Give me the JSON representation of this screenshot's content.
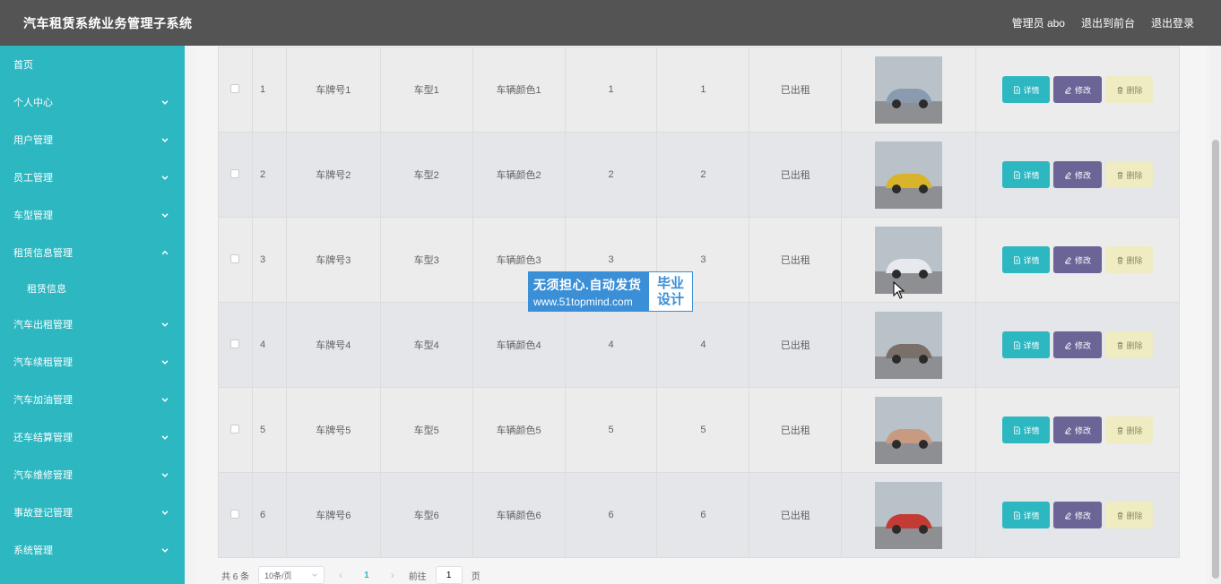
{
  "header": {
    "title": "汽车租赁系统业务管理子系统",
    "admin_label": "管理员 abo",
    "front_label": "退出到前台",
    "logout_label": "退出登录"
  },
  "sidebar": {
    "items": [
      {
        "label": "首页",
        "chevron": "none"
      },
      {
        "label": "个人中心",
        "chevron": "down"
      },
      {
        "label": "用户管理",
        "chevron": "down"
      },
      {
        "label": "员工管理",
        "chevron": "down"
      },
      {
        "label": "车型管理",
        "chevron": "down"
      },
      {
        "label": "租赁信息管理",
        "chevron": "up"
      },
      {
        "label": "租赁信息",
        "chevron": "none",
        "sub": true
      },
      {
        "label": "汽车出租管理",
        "chevron": "down"
      },
      {
        "label": "汽车续租管理",
        "chevron": "down"
      },
      {
        "label": "汽车加油管理",
        "chevron": "down"
      },
      {
        "label": "还车结算管理",
        "chevron": "down"
      },
      {
        "label": "汽车维修管理",
        "chevron": "down"
      },
      {
        "label": "事故登记管理",
        "chevron": "down"
      },
      {
        "label": "系统管理",
        "chevron": "down"
      }
    ]
  },
  "table": {
    "rows": [
      {
        "index": "1",
        "plate": "车牌号1",
        "model": "车型1",
        "color": "车辆颜色1",
        "col5": "1",
        "col6": "1",
        "status": "已出租"
      },
      {
        "index": "2",
        "plate": "车牌号2",
        "model": "车型2",
        "color": "车辆颜色2",
        "col5": "2",
        "col6": "2",
        "status": "已出租"
      },
      {
        "index": "3",
        "plate": "车牌号3",
        "model": "车型3",
        "color": "车辆颜色3",
        "col5": "3",
        "col6": "3",
        "status": "已出租"
      },
      {
        "index": "4",
        "plate": "车牌号4",
        "model": "车型4",
        "color": "车辆颜色4",
        "col5": "4",
        "col6": "4",
        "status": "已出租"
      },
      {
        "index": "5",
        "plate": "车牌号5",
        "model": "车型5",
        "color": "车辆颜色5",
        "col5": "5",
        "col6": "5",
        "status": "已出租"
      },
      {
        "index": "6",
        "plate": "车牌号6",
        "model": "车型6",
        "color": "车辆颜色6",
        "col5": "6",
        "col6": "6",
        "status": "已出租"
      }
    ],
    "thumb_colors": [
      "#8a9bb0",
      "#d9b42a",
      "#e8e8ef",
      "#7b6f6a",
      "#c99a82",
      "#c43a34"
    ],
    "actions": {
      "detail": "详情",
      "edit": "修改",
      "delete": "删除"
    }
  },
  "watermark": {
    "line1": "无须担心.自动发货",
    "line2": "www.51topmind.com",
    "right1": "毕业",
    "right2": "设计"
  },
  "pager": {
    "total": "共 6 条",
    "page_size": "10条/页",
    "current": "1",
    "goto_label": "前往",
    "goto_value": "1",
    "page_suffix": "页"
  },
  "colors": {
    "accent": "#2cb7c1",
    "topbar": "#545454",
    "edit_button": "#6b6496",
    "delete_button": "#eeecc0"
  }
}
